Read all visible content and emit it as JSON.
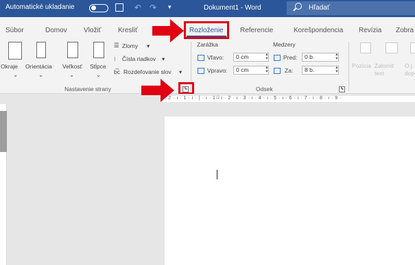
{
  "titlebar": {
    "autosave_label": "Automatické ukladanie",
    "doc_title": "Dokument1 - Word",
    "search_label": "Hľadať"
  },
  "tabs": [
    "Súbor",
    "Domov",
    "Vložiť",
    "Kresliť",
    "Rozloženie",
    "Referencie",
    "Korešpondencia",
    "Revízia",
    "Zobra"
  ],
  "active_tab": "Rozloženie",
  "ribbon": {
    "page_setup": {
      "buttons": [
        "Okraje",
        "Orientácia",
        "Veľkosť",
        "Stĺpce"
      ],
      "breaks": "Zlomy",
      "line_numbers": "Čísla riadkov",
      "hyphenation": "Rozdeľovanie slov",
      "group_label": "Nastavenie strany"
    },
    "paragraph": {
      "indent_header": "Zarážka",
      "spacing_header": "Medzery",
      "left_label": "Vľavo:",
      "left_value": "0 cm",
      "right_label": "Vpravo:",
      "right_value": "0 cm",
      "before_label": "Pred:",
      "before_value": "0 b.",
      "after_label": "Za:",
      "after_value": "8 b.",
      "group_label": "Odsek"
    },
    "arrange": {
      "position": "Pozícia",
      "wrap_text": "Zalomiť text",
      "more": "O j",
      "more2": "dop"
    }
  },
  "ruler": {
    "marks": "· 2 · ı · 1 · ı · | · ı · 1 · ı · 2 · ı · 3 · ı · 4 · ı · 5 · ı · 6 · ı · 7 · ı · 8 · ı · 9 ·"
  },
  "colors": {
    "accent": "#2b579a",
    "highlight_red": "#e00012"
  }
}
